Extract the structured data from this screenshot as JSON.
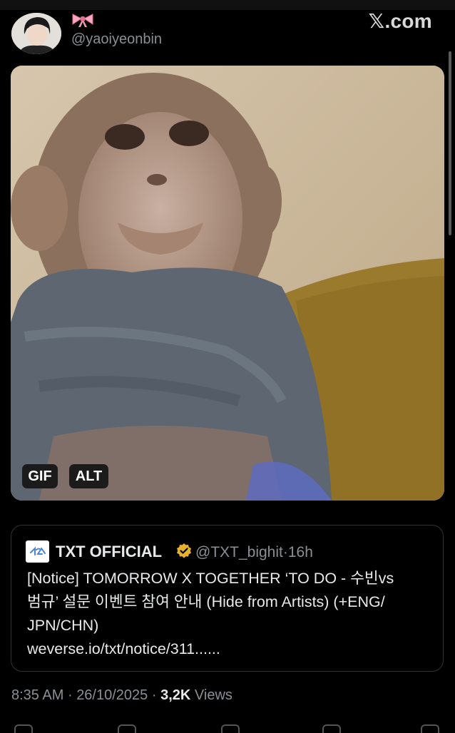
{
  "header": {
    "emoji": "🎀",
    "handle": "@yaoiyeonbin",
    "brand_mark": "𝕏",
    "brand_text": ".com"
  },
  "media": {
    "badge_gif": "GIF",
    "badge_alt": "ALT"
  },
  "quote": {
    "name": "TXT OFFICIAL",
    "handle": "@TXT_bighit",
    "separator": "·",
    "time": "16h",
    "text_line1": "[Notice] TOMORROW X TOGETHER ‘TO DO - 수빈vs",
    "text_line2": "범규’ 설문 이벤트 참여 안내 (Hide from Artists) (+ENG/",
    "text_line3": "JPN/CHN)",
    "text_line4": "weverse.io/txt/notice/311......"
  },
  "footer": {
    "time": "8:35 AM",
    "sep1": "·",
    "date": "26/10/2025",
    "sep2": "·",
    "views_count": "3,2K",
    "views_label": "Views"
  },
  "colors": {
    "background": "#000000",
    "text": "#e7e9ea",
    "muted": "#8b8f94",
    "border": "#2f3336",
    "verified_gold": "#e8b12c"
  }
}
